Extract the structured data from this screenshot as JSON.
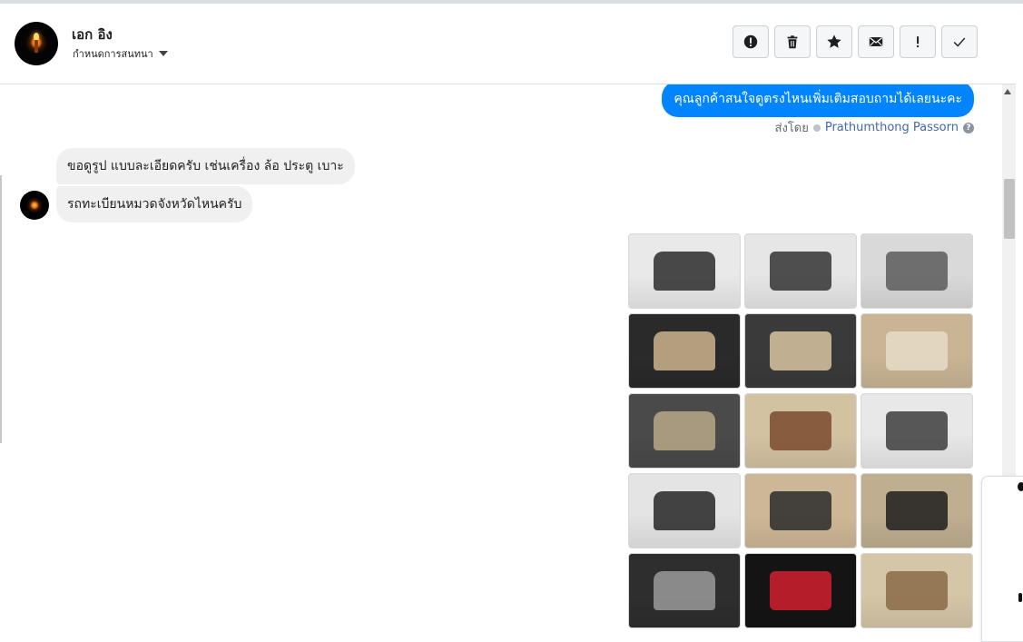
{
  "header": {
    "user_name": "เอก อิง",
    "conversation_setting": "กำหนดการสนทนา",
    "toolbar": [
      {
        "name": "report-button",
        "icon": "exclamation-circle-icon"
      },
      {
        "name": "delete-button",
        "icon": "trash-icon"
      },
      {
        "name": "star-button",
        "icon": "star-icon"
      },
      {
        "name": "mark-unread-button",
        "icon": "envelope-icon"
      },
      {
        "name": "spam-button",
        "icon": "exclamation-icon"
      },
      {
        "name": "done-button",
        "icon": "check-icon"
      }
    ]
  },
  "messages": {
    "outgoing_text": "คุณลูกค้าสนใจดูตรงไหนเพิ่มเติมสอบถามได้เลยนะคะ",
    "sent_by_label": "ส่งโดย",
    "sent_by_name": "Prathumthong Passorn",
    "help_glyph": "?",
    "incoming": [
      "ขอดูรูป แบบละเอียดครับ เช่นเครื่อง ล้อ ประตู เบาะ",
      "รถทะเบียนหมวดจังหวัดไหนครับ"
    ]
  },
  "gallery": [
    {
      "name": "van-front-photo",
      "bg": "#e9e9e9",
      "accent": "#2b2b2b"
    },
    {
      "name": "van-front-angle-photo",
      "bg": "#e6e6e6",
      "accent": "#333333"
    },
    {
      "name": "van-wheel-photo",
      "bg": "#d9d9d9",
      "accent": "#5a5a5a"
    },
    {
      "name": "door-interior-photo",
      "bg": "#2a2a2a",
      "accent": "#cbb48c"
    },
    {
      "name": "steering-wheel-photo",
      "bg": "#3a3a3a",
      "accent": "#d8c4a0"
    },
    {
      "name": "captain-seats-photo",
      "bg": "#c9b595",
      "accent": "#e8dcc6"
    },
    {
      "name": "gear-shift-photo",
      "bg": "#4a4a4a",
      "accent": "#b9a888"
    },
    {
      "name": "rear-cabin-photo",
      "bg": "#d3c2a2",
      "accent": "#7a4b2c"
    },
    {
      "name": "van-rear-photo",
      "bg": "#e8e8e8",
      "accent": "#3d3d3d"
    },
    {
      "name": "van-side-rear-photo",
      "bg": "#e4e4e4",
      "accent": "#262626"
    },
    {
      "name": "front-seats-photo",
      "bg": "#cdb796",
      "accent": "#2b2b2b"
    },
    {
      "name": "seat-controls-photo",
      "bg": "#bfae90",
      "accent": "#1f1f1f"
    },
    {
      "name": "dashboard-console-photo",
      "bg": "#2e2e2e",
      "accent": "#9a9a9a"
    },
    {
      "name": "instrument-cluster-photo",
      "bg": "#141414",
      "accent": "#d21f2f"
    },
    {
      "name": "rear-seats-photo",
      "bg": "#d6c6a8",
      "accent": "#8a6a45"
    }
  ]
}
